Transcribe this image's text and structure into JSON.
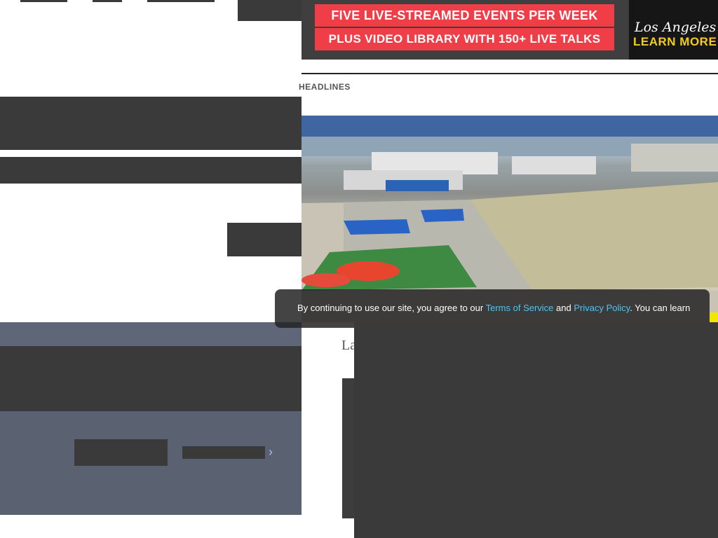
{
  "ad": {
    "line1": "FIVE LIVE-STREAMED EVENTS PER WEEK",
    "line2": "PLUS VIDEO LIBRARY WITH 150+ LIVE TALKS",
    "brand": "Los Angeles Times",
    "cta": "LEARN MORE",
    "colors": {
      "banner": "#ef3e48",
      "cta": "#f2cc1f"
    }
  },
  "section": {
    "headlines_label": "HEADLINES"
  },
  "cookie_banner": {
    "prefix": "By continuing to use our site, you agree to our ",
    "terms_link": "Terms of Service",
    "and": " and ",
    "privacy_link": "Privacy Policy",
    "suffix": ". You can learn"
  },
  "article": {
    "title_fragment": "La"
  },
  "icons": {
    "chevron": "chevron-right-icon"
  }
}
